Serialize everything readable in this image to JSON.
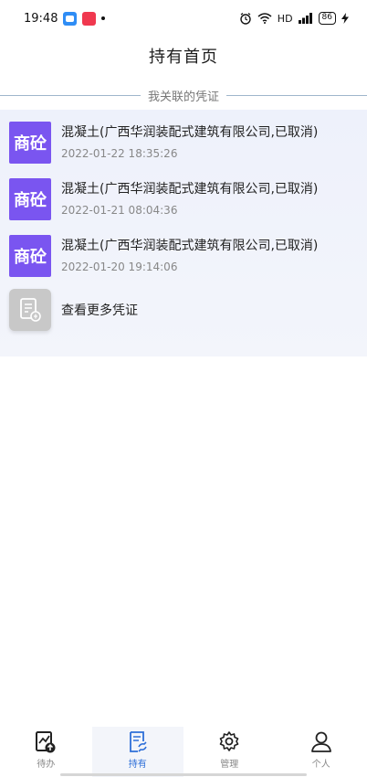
{
  "status_bar": {
    "time": "19:48",
    "network_label": "HD",
    "battery": "86"
  },
  "header": {
    "title": "持有首页"
  },
  "section": {
    "title": "我关联的凭证"
  },
  "vouchers": [
    {
      "icon_text": "商砼",
      "title": "混凝土(广西华润装配式建筑有限公司,已取消)",
      "date": "2022-01-22 18:35:26"
    },
    {
      "icon_text": "商砼",
      "title": "混凝土(广西华润装配式建筑有限公司,已取消)",
      "date": "2022-01-21 08:04:36"
    },
    {
      "icon_text": "商砼",
      "title": "混凝土(广西华润装配式建筑有限公司,已取消)",
      "date": "2022-01-20 19:14:06"
    }
  ],
  "more": {
    "label": "查看更多凭证",
    "icon": "document-icon"
  },
  "bottom_nav": [
    {
      "label": "待办",
      "icon": "todo-chart-icon",
      "active": false
    },
    {
      "label": "持有",
      "icon": "hold-document-icon",
      "active": true
    },
    {
      "label": "管理",
      "icon": "gear-icon",
      "active": false
    },
    {
      "label": "个人",
      "icon": "person-icon",
      "active": false
    }
  ],
  "colors": {
    "accent": "#2e6fd8",
    "voucher_icon": "#7a55f0",
    "card_bg": "#eef1fb"
  }
}
